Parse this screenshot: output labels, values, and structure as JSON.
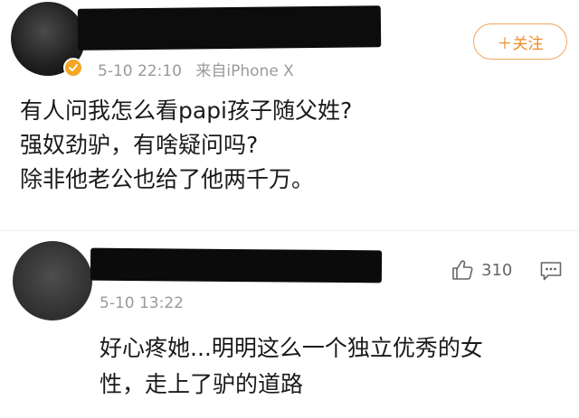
{
  "post": {
    "timestamp": "5-10 22:10",
    "source": "来自iPhone X",
    "follow_label": "＋关注",
    "lines": [
      "有人问我怎么看papi孩子随父姓?",
      "强奴劲驴，有啥疑问吗?",
      "除非他老公也给了他两千万。"
    ]
  },
  "comment": {
    "timestamp": "5-10 13:22",
    "like_count": "310",
    "lines": [
      "好心疼她...明明这么一个独立优秀的女",
      "性，走上了驴的道路"
    ]
  },
  "icons": {
    "verified": "verified-badge-icon",
    "like": "thumbs-up-icon",
    "reply": "comment-icon"
  },
  "colors": {
    "follow_accent": "#f08a24",
    "verified": "#f5a623",
    "meta_text": "#9a9a9a"
  }
}
